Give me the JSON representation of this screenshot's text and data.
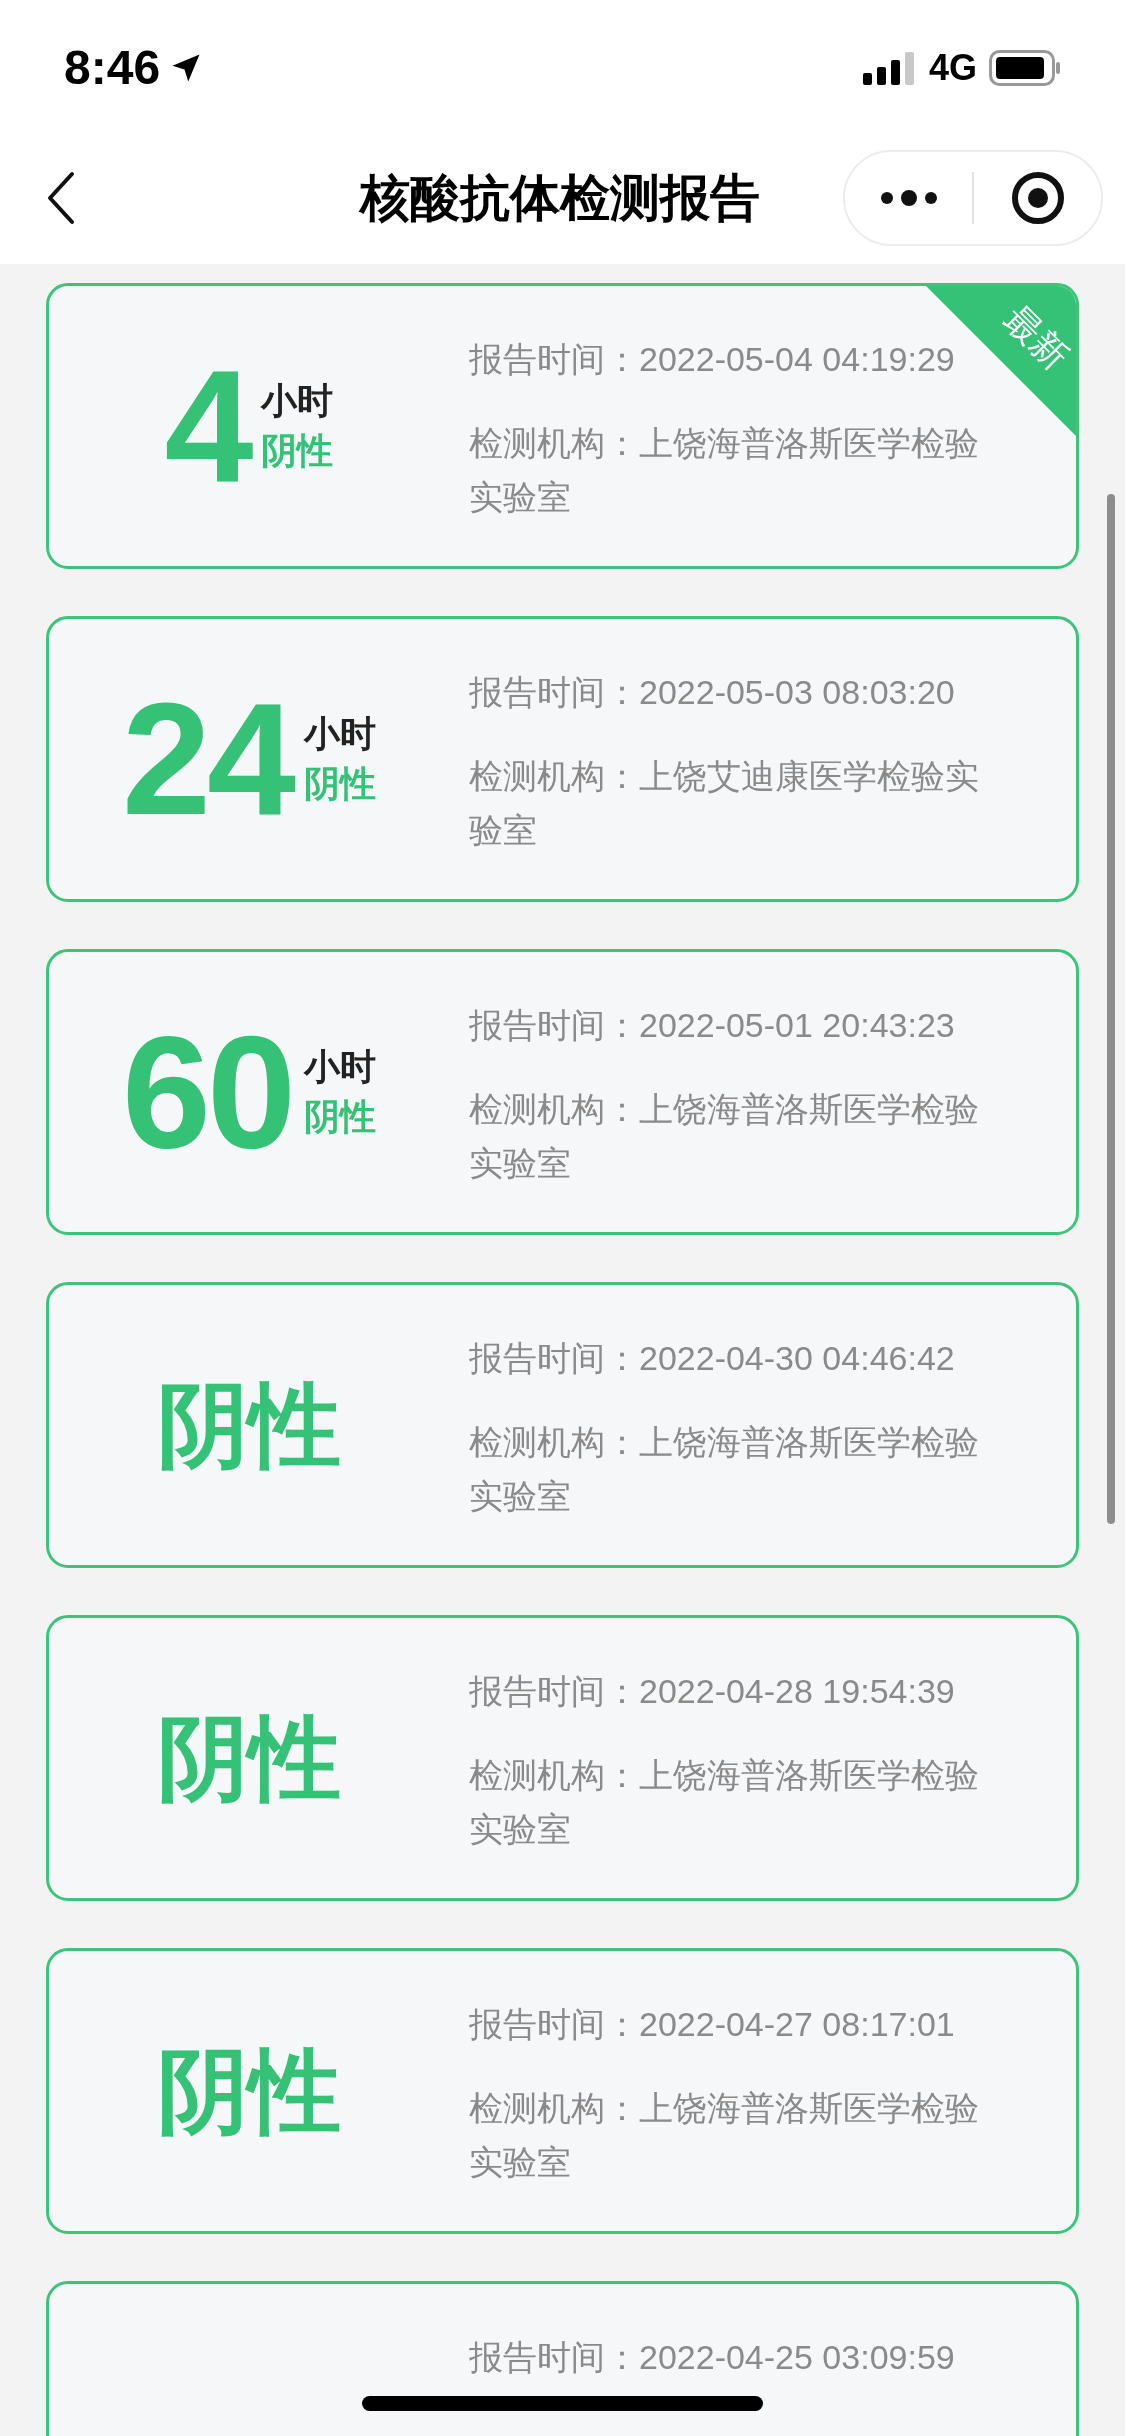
{
  "status_bar": {
    "time": "8:46",
    "network": "4G"
  },
  "nav": {
    "title": "核酸抗体检测报告"
  },
  "reports": [
    {
      "kind": "hours",
      "hours": "4",
      "unit": "小时",
      "result": "阴性",
      "badge": "最新",
      "time_label": "报告时间：",
      "time": "2022-05-04 04:19:29",
      "org_label": "检测机构：",
      "org": "上饶海普洛斯医学检验实验室"
    },
    {
      "kind": "hours",
      "hours": "24",
      "unit": "小时",
      "result": "阴性",
      "time_label": "报告时间：",
      "time": "2022-05-03 08:03:20",
      "org_label": "检测机构：",
      "org": "上饶艾迪康医学检验实验室"
    },
    {
      "kind": "hours",
      "hours": "60",
      "unit": "小时",
      "result": "阴性",
      "time_label": "报告时间：",
      "time": "2022-05-01 20:43:23",
      "org_label": "检测机构：",
      "org": "上饶海普洛斯医学检验实验室"
    },
    {
      "kind": "result",
      "result": "阴性",
      "time_label": "报告时间：",
      "time": "2022-04-30 04:46:42",
      "org_label": "检测机构：",
      "org": "上饶海普洛斯医学检验实验室"
    },
    {
      "kind": "result",
      "result": "阴性",
      "time_label": "报告时间：",
      "time": "2022-04-28 19:54:39",
      "org_label": "检测机构：",
      "org": "上饶海普洛斯医学检验实验室"
    },
    {
      "kind": "result",
      "result": "阴性",
      "time_label": "报告时间：",
      "time": "2022-04-27 08:17:01",
      "org_label": "检测机构：",
      "org": "上饶海普洛斯医学检验实验室"
    },
    {
      "kind": "result",
      "time_label": "报告时间：",
      "time": "2022-04-25 03:09:59"
    }
  ]
}
